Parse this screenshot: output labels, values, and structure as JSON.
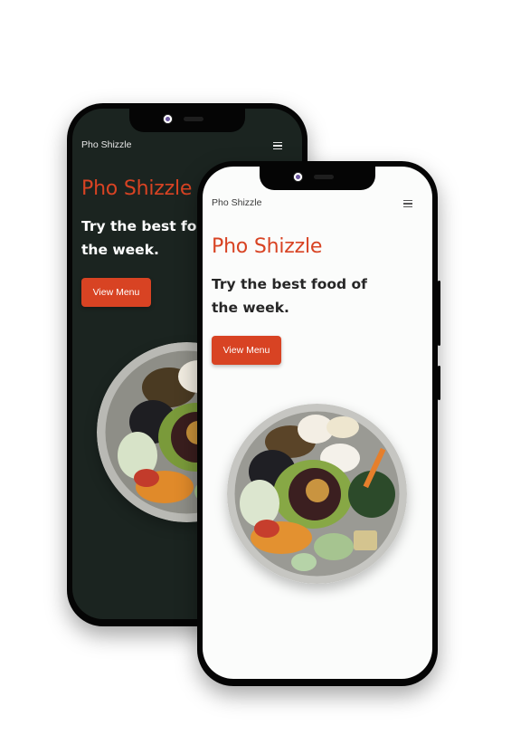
{
  "mockups": [
    {
      "theme": "dark",
      "nav": {
        "brand": "Pho Shizzle",
        "menu_icon": "hamburger-icon"
      },
      "hero": {
        "title": "Pho Shizzle",
        "subtitle": "Try the best foo the week.",
        "cta_label": "View Menu"
      },
      "image": {
        "icon": "food-bowl-image"
      }
    },
    {
      "theme": "light",
      "nav": {
        "brand": "Pho Shizzle",
        "menu_icon": "hamburger-icon"
      },
      "hero": {
        "title": "Pho Shizzle",
        "subtitle": "Try the best food of the week.",
        "cta_label": "View Menu"
      },
      "image": {
        "icon": "food-bowl-image"
      }
    }
  ],
  "colors": {
    "accent": "#d84323",
    "dark_bg": "#1b2420",
    "light_bg": "#fbfcfb"
  }
}
